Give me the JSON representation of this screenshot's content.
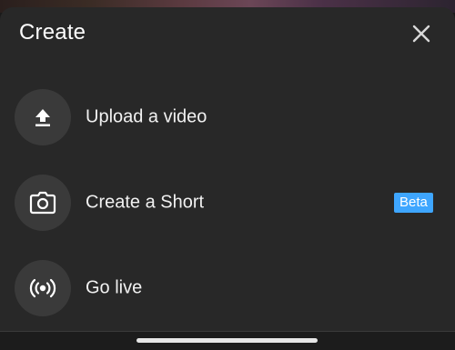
{
  "sheet": {
    "title": "Create",
    "close_icon": "close-icon"
  },
  "items": [
    {
      "label": "Upload a video",
      "icon": "upload-icon"
    },
    {
      "label": "Create a Short",
      "icon": "camera-icon",
      "badge": "Beta"
    },
    {
      "label": "Go live",
      "icon": "live-broadcast-icon"
    }
  ],
  "colors": {
    "sheet_background": "#282828",
    "icon_circle": "#3a3a3a",
    "badge": "#3ea6ff",
    "text": "#f1f1f1"
  }
}
